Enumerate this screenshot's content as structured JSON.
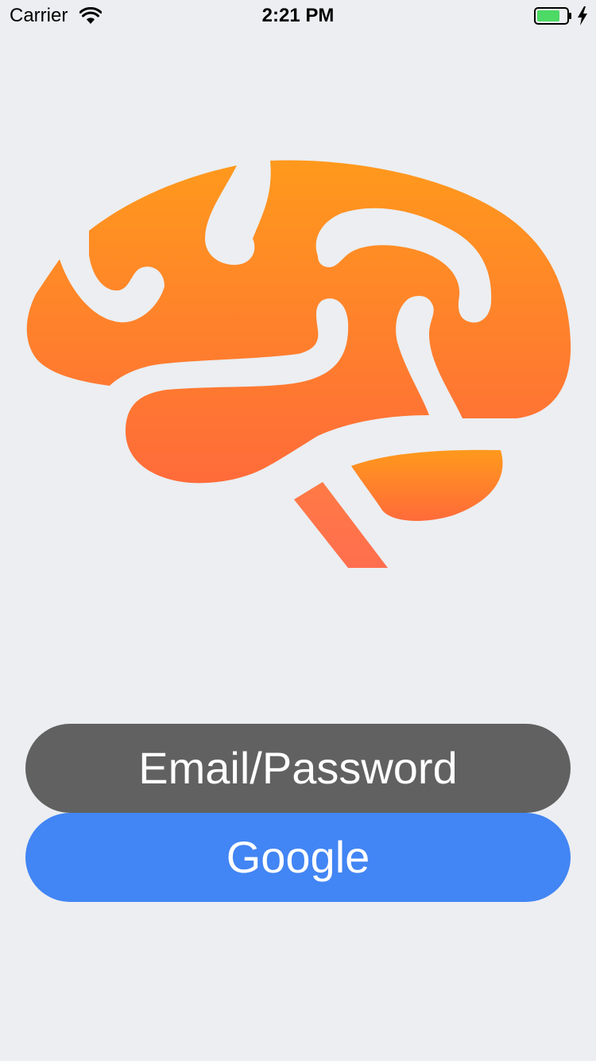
{
  "status_bar": {
    "carrier": "Carrier",
    "time": "2:21 PM",
    "icons": [
      "wifi-icon",
      "battery-icon",
      "charging-bolt-icon"
    ],
    "battery_color": "#4cd964"
  },
  "logo": {
    "icon": "brain-logo",
    "gradient_top": "#ff991c",
    "gradient_bottom": "#ff6b3a"
  },
  "buttons": {
    "email_password": "Email/Password",
    "google": "Google"
  },
  "colors": {
    "background": "#eceef1",
    "email_button": "#616161",
    "google_button": "#4285f4"
  }
}
